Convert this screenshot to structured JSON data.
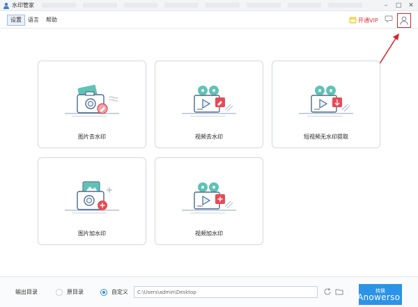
{
  "window": {
    "title": "水印管家"
  },
  "menu": {
    "items": [
      "设置",
      "语言",
      "帮助"
    ]
  },
  "vip": {
    "label": "开通VIP"
  },
  "cards": [
    {
      "label": "图片去水印",
      "icon": "photo-remove-watermark-icon"
    },
    {
      "label": "视频去水印",
      "icon": "video-remove-watermark-icon"
    },
    {
      "label": "短视频无水印提取",
      "icon": "short-video-extract-icon"
    },
    {
      "label": "图片加水印",
      "icon": "photo-add-watermark-icon"
    },
    {
      "label": "视频加水印",
      "icon": "video-add-watermark-icon"
    }
  ],
  "footer": {
    "output_label": "输出目录",
    "option_original": "原目录",
    "option_custom": "自定义",
    "path_value": "C:\\Users\\admin\\Desktop",
    "convert_label": "转换"
  },
  "watermark_text": "Anowerso",
  "colors": {
    "accent": "#2b93e8",
    "vip_red": "#e0303a",
    "annotation_red": "#d9232c"
  }
}
